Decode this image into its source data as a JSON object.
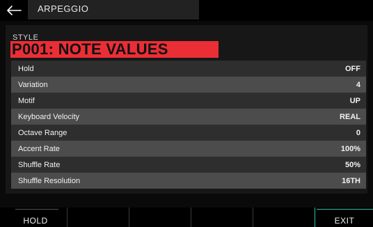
{
  "header": {
    "title": "ARPEGGIO",
    "back_icon": "back-arrow-icon"
  },
  "style": {
    "label": "STYLE",
    "value": "P001: NOTE VALUES",
    "highlight_color": "#ea2e36"
  },
  "params": [
    {
      "label": "Hold",
      "value": "OFF"
    },
    {
      "label": "Variation",
      "value": "4"
    },
    {
      "label": "Motif",
      "value": "UP"
    },
    {
      "label": "Keyboard Velocity",
      "value": "REAL"
    },
    {
      "label": "Octave Range",
      "value": "0"
    },
    {
      "label": "Accent Rate",
      "value": "100%"
    },
    {
      "label": "Shuffle Rate",
      "value": "50%"
    },
    {
      "label": "Shuffle Resolution",
      "value": "16TH"
    }
  ],
  "softkeys": {
    "hold_label": "HOLD",
    "exit_label": "EXIT",
    "exit_accent_color": "#2fbfae"
  }
}
